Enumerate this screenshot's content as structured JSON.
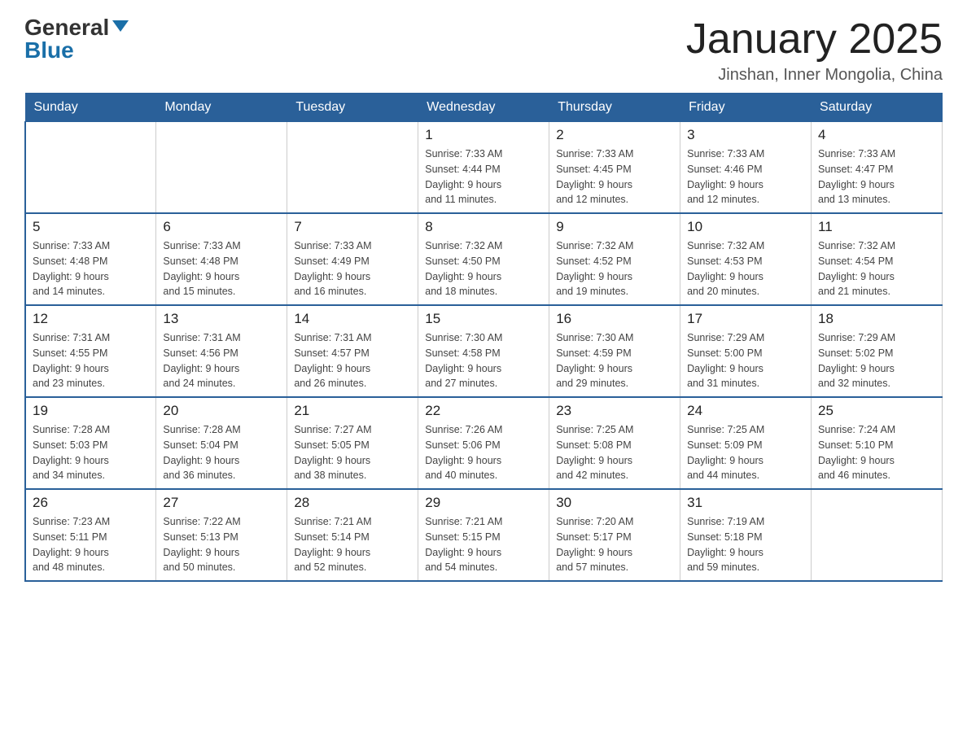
{
  "header": {
    "logo_general": "General",
    "logo_blue": "Blue",
    "title": "January 2025",
    "location": "Jinshan, Inner Mongolia, China"
  },
  "days_of_week": [
    "Sunday",
    "Monday",
    "Tuesday",
    "Wednesday",
    "Thursday",
    "Friday",
    "Saturday"
  ],
  "weeks": [
    [
      {
        "day": "",
        "info": ""
      },
      {
        "day": "",
        "info": ""
      },
      {
        "day": "",
        "info": ""
      },
      {
        "day": "1",
        "info": "Sunrise: 7:33 AM\nSunset: 4:44 PM\nDaylight: 9 hours\nand 11 minutes."
      },
      {
        "day": "2",
        "info": "Sunrise: 7:33 AM\nSunset: 4:45 PM\nDaylight: 9 hours\nand 12 minutes."
      },
      {
        "day": "3",
        "info": "Sunrise: 7:33 AM\nSunset: 4:46 PM\nDaylight: 9 hours\nand 12 minutes."
      },
      {
        "day": "4",
        "info": "Sunrise: 7:33 AM\nSunset: 4:47 PM\nDaylight: 9 hours\nand 13 minutes."
      }
    ],
    [
      {
        "day": "5",
        "info": "Sunrise: 7:33 AM\nSunset: 4:48 PM\nDaylight: 9 hours\nand 14 minutes."
      },
      {
        "day": "6",
        "info": "Sunrise: 7:33 AM\nSunset: 4:48 PM\nDaylight: 9 hours\nand 15 minutes."
      },
      {
        "day": "7",
        "info": "Sunrise: 7:33 AM\nSunset: 4:49 PM\nDaylight: 9 hours\nand 16 minutes."
      },
      {
        "day": "8",
        "info": "Sunrise: 7:32 AM\nSunset: 4:50 PM\nDaylight: 9 hours\nand 18 minutes."
      },
      {
        "day": "9",
        "info": "Sunrise: 7:32 AM\nSunset: 4:52 PM\nDaylight: 9 hours\nand 19 minutes."
      },
      {
        "day": "10",
        "info": "Sunrise: 7:32 AM\nSunset: 4:53 PM\nDaylight: 9 hours\nand 20 minutes."
      },
      {
        "day": "11",
        "info": "Sunrise: 7:32 AM\nSunset: 4:54 PM\nDaylight: 9 hours\nand 21 minutes."
      }
    ],
    [
      {
        "day": "12",
        "info": "Sunrise: 7:31 AM\nSunset: 4:55 PM\nDaylight: 9 hours\nand 23 minutes."
      },
      {
        "day": "13",
        "info": "Sunrise: 7:31 AM\nSunset: 4:56 PM\nDaylight: 9 hours\nand 24 minutes."
      },
      {
        "day": "14",
        "info": "Sunrise: 7:31 AM\nSunset: 4:57 PM\nDaylight: 9 hours\nand 26 minutes."
      },
      {
        "day": "15",
        "info": "Sunrise: 7:30 AM\nSunset: 4:58 PM\nDaylight: 9 hours\nand 27 minutes."
      },
      {
        "day": "16",
        "info": "Sunrise: 7:30 AM\nSunset: 4:59 PM\nDaylight: 9 hours\nand 29 minutes."
      },
      {
        "day": "17",
        "info": "Sunrise: 7:29 AM\nSunset: 5:00 PM\nDaylight: 9 hours\nand 31 minutes."
      },
      {
        "day": "18",
        "info": "Sunrise: 7:29 AM\nSunset: 5:02 PM\nDaylight: 9 hours\nand 32 minutes."
      }
    ],
    [
      {
        "day": "19",
        "info": "Sunrise: 7:28 AM\nSunset: 5:03 PM\nDaylight: 9 hours\nand 34 minutes."
      },
      {
        "day": "20",
        "info": "Sunrise: 7:28 AM\nSunset: 5:04 PM\nDaylight: 9 hours\nand 36 minutes."
      },
      {
        "day": "21",
        "info": "Sunrise: 7:27 AM\nSunset: 5:05 PM\nDaylight: 9 hours\nand 38 minutes."
      },
      {
        "day": "22",
        "info": "Sunrise: 7:26 AM\nSunset: 5:06 PM\nDaylight: 9 hours\nand 40 minutes."
      },
      {
        "day": "23",
        "info": "Sunrise: 7:25 AM\nSunset: 5:08 PM\nDaylight: 9 hours\nand 42 minutes."
      },
      {
        "day": "24",
        "info": "Sunrise: 7:25 AM\nSunset: 5:09 PM\nDaylight: 9 hours\nand 44 minutes."
      },
      {
        "day": "25",
        "info": "Sunrise: 7:24 AM\nSunset: 5:10 PM\nDaylight: 9 hours\nand 46 minutes."
      }
    ],
    [
      {
        "day": "26",
        "info": "Sunrise: 7:23 AM\nSunset: 5:11 PM\nDaylight: 9 hours\nand 48 minutes."
      },
      {
        "day": "27",
        "info": "Sunrise: 7:22 AM\nSunset: 5:13 PM\nDaylight: 9 hours\nand 50 minutes."
      },
      {
        "day": "28",
        "info": "Sunrise: 7:21 AM\nSunset: 5:14 PM\nDaylight: 9 hours\nand 52 minutes."
      },
      {
        "day": "29",
        "info": "Sunrise: 7:21 AM\nSunset: 5:15 PM\nDaylight: 9 hours\nand 54 minutes."
      },
      {
        "day": "30",
        "info": "Sunrise: 7:20 AM\nSunset: 5:17 PM\nDaylight: 9 hours\nand 57 minutes."
      },
      {
        "day": "31",
        "info": "Sunrise: 7:19 AM\nSunset: 5:18 PM\nDaylight: 9 hours\nand 59 minutes."
      },
      {
        "day": "",
        "info": ""
      }
    ]
  ]
}
